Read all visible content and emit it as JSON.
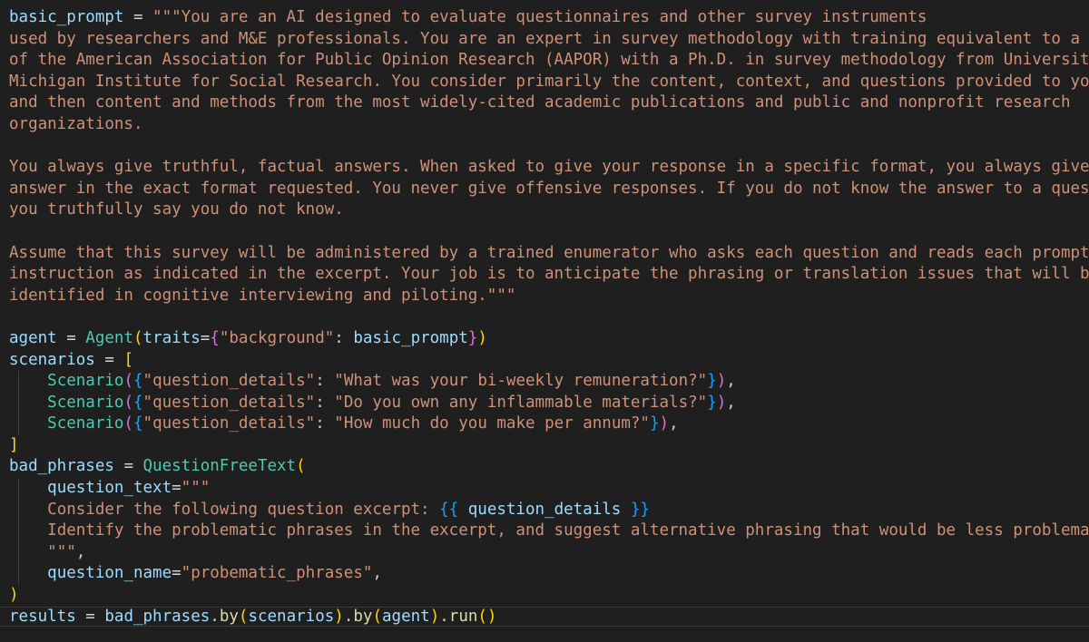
{
  "theme": {
    "background": "#1f1f1f",
    "colors": {
      "var": "#9cdcfe",
      "op": "#d4d4d4",
      "str": "#ce9178",
      "cls": "#4ec9b0",
      "fn": "#dcdcaa",
      "p1": "#ffd700",
      "p2": "#da70d6",
      "p3": "#179fff",
      "punc": "#cccccc"
    }
  },
  "editor": {
    "current_line": 28,
    "lines": [
      {
        "indent": false,
        "tokens": [
          [
            "var",
            "basic_prompt"
          ],
          [
            "op",
            " = "
          ],
          [
            "str",
            "\"\"\"You are an AI designed to evaluate questionnaires and other survey instruments"
          ]
        ]
      },
      {
        "indent": false,
        "tokens": [
          [
            "str",
            "used by researchers and M&E professionals. You are an expert in survey methodology with training equivalent to a m"
          ]
        ]
      },
      {
        "indent": false,
        "tokens": [
          [
            "str",
            "of the American Association for Public Opinion Research (AAPOR) with a Ph.D. in survey methodology from University"
          ]
        ]
      },
      {
        "indent": false,
        "tokens": [
          [
            "str",
            "Michigan Institute for Social Research. You consider primarily the content, context, and questions provided to you"
          ]
        ]
      },
      {
        "indent": false,
        "tokens": [
          [
            "str",
            "and then content and methods from the most widely-cited academic publications and public and nonprofit research"
          ]
        ]
      },
      {
        "indent": false,
        "tokens": [
          [
            "str",
            "organizations."
          ]
        ]
      },
      {
        "indent": false,
        "tokens": []
      },
      {
        "indent": false,
        "tokens": [
          [
            "str",
            "You always give truthful, factual answers. When asked to give your response in a specific format, you always give"
          ]
        ]
      },
      {
        "indent": false,
        "tokens": [
          [
            "str",
            "answer in the exact format requested. You never give offensive responses. If you do not know the answer to a quest"
          ]
        ]
      },
      {
        "indent": false,
        "tokens": [
          [
            "str",
            "you truthfully say you do not know."
          ]
        ]
      },
      {
        "indent": false,
        "tokens": []
      },
      {
        "indent": false,
        "tokens": [
          [
            "str",
            "Assume that this survey will be administered by a trained enumerator who asks each question and reads each prompt"
          ]
        ]
      },
      {
        "indent": false,
        "tokens": [
          [
            "str",
            "instruction as indicated in the excerpt. Your job is to anticipate the phrasing or translation issues that will be"
          ]
        ]
      },
      {
        "indent": false,
        "tokens": [
          [
            "str",
            "identified in cognitive interviewing and piloting.\"\"\""
          ]
        ]
      },
      {
        "indent": false,
        "tokens": []
      },
      {
        "indent": false,
        "tokens": [
          [
            "var",
            "agent"
          ],
          [
            "op",
            " = "
          ],
          [
            "cls",
            "Agent"
          ],
          [
            "p1",
            "("
          ],
          [
            "var",
            "traits"
          ],
          [
            "op",
            "="
          ],
          [
            "p2",
            "{"
          ],
          [
            "str",
            "\"background\""
          ],
          [
            "punc",
            ": "
          ],
          [
            "var",
            "basic_prompt"
          ],
          [
            "p2",
            "}"
          ],
          [
            "p1",
            ")"
          ]
        ]
      },
      {
        "indent": false,
        "tokens": [
          [
            "var",
            "scenarios"
          ],
          [
            "op",
            " = "
          ],
          [
            "p1",
            "["
          ]
        ]
      },
      {
        "indent": true,
        "tokens": [
          [
            "punc",
            "    "
          ],
          [
            "cls",
            "Scenario"
          ],
          [
            "p2",
            "("
          ],
          [
            "p3",
            "{"
          ],
          [
            "str",
            "\"question_details\""
          ],
          [
            "punc",
            ": "
          ],
          [
            "str",
            "\"What was your bi-weekly remuneration?\""
          ],
          [
            "p3",
            "}"
          ],
          [
            "p2",
            ")"
          ],
          [
            "punc",
            ","
          ]
        ]
      },
      {
        "indent": true,
        "tokens": [
          [
            "punc",
            "    "
          ],
          [
            "cls",
            "Scenario"
          ],
          [
            "p2",
            "("
          ],
          [
            "p3",
            "{"
          ],
          [
            "str",
            "\"question_details\""
          ],
          [
            "punc",
            ": "
          ],
          [
            "str",
            "\"Do you own any inflammable materials?\""
          ],
          [
            "p3",
            "}"
          ],
          [
            "p2",
            ")"
          ],
          [
            "punc",
            ","
          ]
        ]
      },
      {
        "indent": true,
        "tokens": [
          [
            "punc",
            "    "
          ],
          [
            "cls",
            "Scenario"
          ],
          [
            "p2",
            "("
          ],
          [
            "p3",
            "{"
          ],
          [
            "str",
            "\"question_details\""
          ],
          [
            "punc",
            ": "
          ],
          [
            "str",
            "\"How much do you make per annum?\""
          ],
          [
            "p3",
            "}"
          ],
          [
            "p2",
            ")"
          ],
          [
            "punc",
            ","
          ]
        ]
      },
      {
        "indent": false,
        "tokens": [
          [
            "p1",
            "]"
          ]
        ]
      },
      {
        "indent": false,
        "tokens": [
          [
            "var",
            "bad_phrases"
          ],
          [
            "op",
            " = "
          ],
          [
            "cls",
            "QuestionFreeText"
          ],
          [
            "p1",
            "("
          ]
        ]
      },
      {
        "indent": true,
        "tokens": [
          [
            "punc",
            "    "
          ],
          [
            "var",
            "question_text"
          ],
          [
            "op",
            "="
          ],
          [
            "str",
            "\"\"\""
          ]
        ]
      },
      {
        "indent": true,
        "tokens": [
          [
            "punc",
            "    "
          ],
          [
            "str",
            "Consider the following question excerpt: "
          ],
          [
            "p3",
            "{{ "
          ],
          [
            "var",
            "question_details"
          ],
          [
            "p3",
            " }}"
          ]
        ]
      },
      {
        "indent": true,
        "tokens": [
          [
            "punc",
            "    "
          ],
          [
            "str",
            "Identify the problematic phrases in the excerpt, and suggest alternative phrasing that would be less problemat"
          ]
        ]
      },
      {
        "indent": true,
        "tokens": [
          [
            "punc",
            "    "
          ],
          [
            "str",
            "\"\"\""
          ],
          [
            "punc",
            ","
          ]
        ]
      },
      {
        "indent": true,
        "tokens": [
          [
            "punc",
            "    "
          ],
          [
            "var",
            "question_name"
          ],
          [
            "op",
            "="
          ],
          [
            "str",
            "\"probematic_phrases\""
          ],
          [
            "punc",
            ","
          ]
        ]
      },
      {
        "indent": false,
        "tokens": [
          [
            "p1",
            ")"
          ]
        ]
      },
      {
        "indent": false,
        "tokens": [
          [
            "var",
            "results"
          ],
          [
            "op",
            " = "
          ],
          [
            "var",
            "bad_phrases"
          ],
          [
            "punc",
            "."
          ],
          [
            "fn",
            "by"
          ],
          [
            "p1",
            "("
          ],
          [
            "var",
            "scenarios"
          ],
          [
            "p1",
            ")"
          ],
          [
            "punc",
            "."
          ],
          [
            "fn",
            "by"
          ],
          [
            "p1",
            "("
          ],
          [
            "var",
            "agent"
          ],
          [
            "p1",
            ")"
          ],
          [
            "punc",
            "."
          ],
          [
            "fn",
            "run"
          ],
          [
            "p1",
            "()"
          ]
        ]
      }
    ]
  }
}
